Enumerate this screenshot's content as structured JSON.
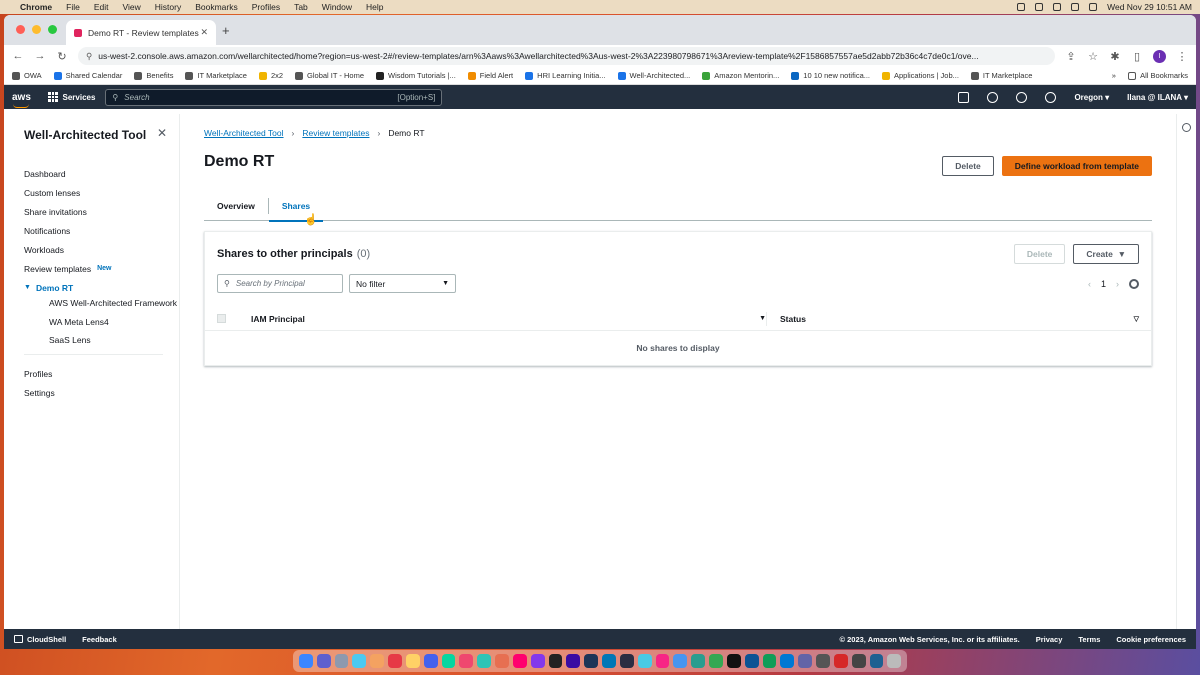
{
  "mac_menubar": {
    "app": "Chrome",
    "items": [
      "File",
      "Edit",
      "View",
      "History",
      "Bookmarks",
      "Profiles",
      "Tab",
      "Window",
      "Help"
    ],
    "clock": "Wed Nov 29  10:51 AM"
  },
  "browser": {
    "tab_title": "Demo RT - Review templates",
    "url": "us-west-2.console.aws.amazon.com/wellarchitected/home?region=us-west-2#/review-templates/arn%3Aaws%3Awellarchitected%3Aus-west-2%3A223980798671%3Areview-template%2F1586857557ae5d2abb72b36c4c7de0c1/ove...",
    "profile_initial": "I",
    "bookmarks": [
      {
        "label": "OWA",
        "color": "#555555"
      },
      {
        "label": "Shared Calendar",
        "color": "#1a73e8"
      },
      {
        "label": "Benefits",
        "color": "#555555"
      },
      {
        "label": "IT Marketplace",
        "color": "#555555"
      },
      {
        "label": "2x2",
        "color": "#f0b400"
      },
      {
        "label": "Global IT - Home",
        "color": "#555555"
      },
      {
        "label": "Wisdom Tutorials |...",
        "color": "#222222"
      },
      {
        "label": "Field Alert",
        "color": "#f08c00"
      },
      {
        "label": "HRI Learning Initia...",
        "color": "#1a73e8"
      },
      {
        "label": "Well-Architected...",
        "color": "#1a73e8"
      },
      {
        "label": "Amazon Mentorin...",
        "color": "#3aa33a"
      },
      {
        "label": "10 10 new notifica...",
        "color": "#0a66c2"
      },
      {
        "label": "Applications | Job...",
        "color": "#f0b400"
      },
      {
        "label": "IT Marketplace",
        "color": "#555555"
      }
    ],
    "all_bookmarks": "All Bookmarks"
  },
  "aws_header": {
    "logo": "aws",
    "services": "Services",
    "search_placeholder": "Search",
    "search_shortcut": "[Option+S]",
    "region": "Oregon ▾",
    "user": "Ilana @ ILANA ▾"
  },
  "sidenav": {
    "title": "Well-Architected Tool",
    "items": [
      "Dashboard",
      "Custom lenses",
      "Share invitations",
      "Notifications",
      "Workloads"
    ],
    "review_templates": "Review templates",
    "new_badge": "New",
    "active": "Demo RT",
    "sub_items": [
      "AWS Well-Architected Framework",
      "WA Meta Lens4",
      "SaaS Lens"
    ],
    "bottom_items": [
      "Profiles",
      "Settings"
    ]
  },
  "main": {
    "breadcrumb": [
      "Well-Architected Tool",
      "Review templates",
      "Demo RT"
    ],
    "title": "Demo RT",
    "delete_label": "Delete",
    "define_label": "Define workload from template",
    "tabs": [
      "Overview",
      "Shares"
    ],
    "selected_tab": "Shares",
    "panel": {
      "title": "Shares to other principals",
      "count": "(0)",
      "delete_label": "Delete",
      "create_label": "Create",
      "search_placeholder": "Search by Principal",
      "filter_value": "No filter",
      "page": "1",
      "columns": [
        "IAM Principal",
        "Status"
      ],
      "empty_text": "No shares to display"
    }
  },
  "footer": {
    "cloudshell": "CloudShell",
    "feedback": "Feedback",
    "copyright": "© 2023, Amazon Web Services, Inc. or its affiliates.",
    "links": [
      "Privacy",
      "Terms",
      "Cookie preferences"
    ]
  },
  "colors": {
    "aws_nav": "#232f3e",
    "link_blue": "#0073bb",
    "primary_orange": "#ec7211"
  }
}
